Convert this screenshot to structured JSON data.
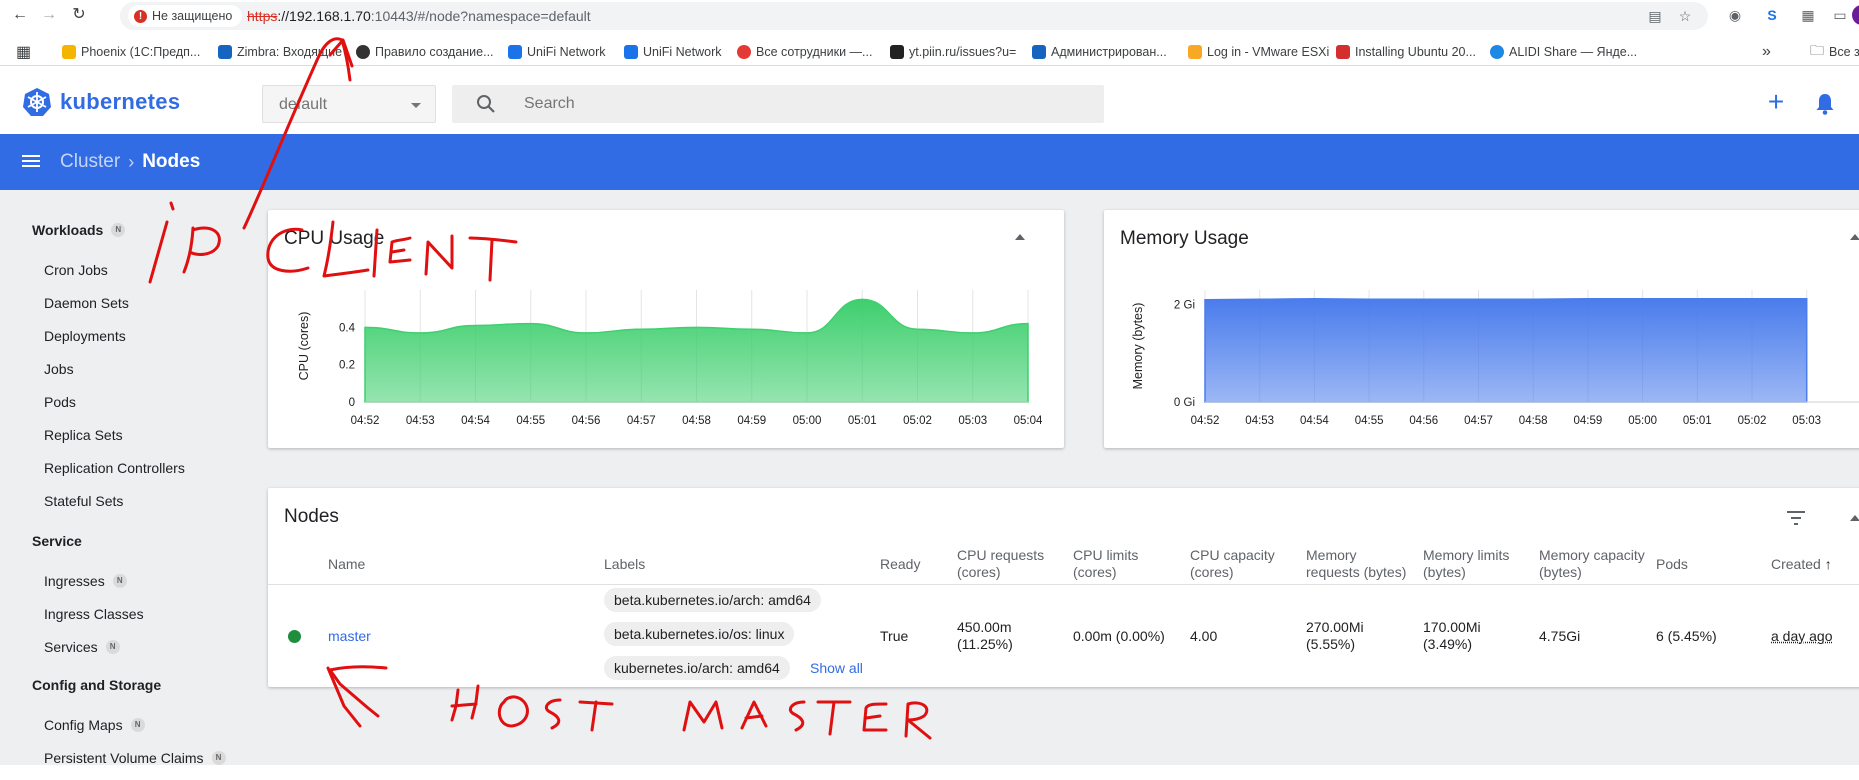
{
  "browser": {
    "security_label": "Не защищено",
    "url_scheme": "https",
    "url_rest_host": "://192.168.1.70",
    "url_path": ":10443/#/node?namespace=default",
    "bookmarks": [
      {
        "label": "Phoenix (1С:Предп...",
        "color": "#f4b400"
      },
      {
        "label": "Zimbra: Входящие",
        "color": "#1565c0"
      },
      {
        "label": "Правило создание...",
        "color": "#333333"
      },
      {
        "label": "UniFi Network",
        "color": "#1a73e8"
      },
      {
        "label": "UniFi Network",
        "color": "#1a73e8"
      },
      {
        "label": "Все сотрудники —...",
        "color": "#e53935"
      },
      {
        "label": "yt.piin.ru/issues?u=",
        "color": "#222222"
      },
      {
        "label": "Администрирован...",
        "color": "#1565c0"
      },
      {
        "label": "Log in - VMware ESXi",
        "color": "#f9a825"
      },
      {
        "label": "Installing Ubuntu 20...",
        "color": "#d32f2f"
      },
      {
        "label": "ALIDI Share — Янде...",
        "color": "#1e88e5"
      },
      {
        "label": "Все з",
        "color": "#5f6368"
      }
    ]
  },
  "header": {
    "logo_text": "kubernetes",
    "namespace": "default",
    "search_placeholder": "Search"
  },
  "breadcrumb": {
    "parent": "Cluster",
    "current": "Nodes"
  },
  "sidebar": {
    "groups": [
      {
        "title": "Workloads",
        "badge": "N",
        "items": [
          {
            "label": "Cron Jobs",
            "badge": ""
          },
          {
            "label": "Daemon Sets",
            "badge": ""
          },
          {
            "label": "Deployments",
            "badge": ""
          },
          {
            "label": "Jobs",
            "badge": ""
          },
          {
            "label": "Pods",
            "badge": ""
          },
          {
            "label": "Replica Sets",
            "badge": ""
          },
          {
            "label": "Replication Controllers",
            "badge": ""
          },
          {
            "label": "Stateful Sets",
            "badge": ""
          }
        ]
      },
      {
        "title": "Service",
        "badge": "",
        "items": [
          {
            "label": "Ingresses",
            "badge": "N"
          },
          {
            "label": "Ingress Classes",
            "badge": ""
          },
          {
            "label": "Services",
            "badge": "N"
          }
        ]
      },
      {
        "title": "Config and Storage",
        "badge": "",
        "items": [
          {
            "label": "Config Maps",
            "badge": "N"
          },
          {
            "label": "Persistent Volume Claims",
            "badge": "N"
          }
        ]
      }
    ]
  },
  "cpu_card": {
    "title": "CPU Usage"
  },
  "memory_card": {
    "title": "Memory Usage"
  },
  "chart_data": [
    {
      "type": "area",
      "title": "CPU Usage",
      "xlabel": "",
      "ylabel": "CPU (cores)",
      "x": [
        "04:52",
        "04:53",
        "04:54",
        "04:55",
        "04:56",
        "04:57",
        "04:58",
        "04:59",
        "05:00",
        "05:01",
        "05:02",
        "05:03",
        "05:04"
      ],
      "values": [
        0.4,
        0.37,
        0.41,
        0.42,
        0.37,
        0.39,
        0.4,
        0.39,
        0.37,
        0.55,
        0.39,
        0.37,
        0.42
      ],
      "yticks": [
        "0",
        "0.2",
        "0.4"
      ],
      "ylim": [
        0,
        0.6
      ],
      "color": "#3ecf6e",
      "grid": true
    },
    {
      "type": "area",
      "title": "Memory Usage",
      "xlabel": "",
      "ylabel": "Memory (bytes)",
      "x": [
        "04:52",
        "04:53",
        "04:54",
        "04:55",
        "04:56",
        "04:57",
        "04:58",
        "04:59",
        "05:00",
        "05:01",
        "05:02",
        "05:03"
      ],
      "values": [
        2.1,
        2.11,
        2.12,
        2.11,
        2.11,
        2.11,
        2.11,
        2.12,
        2.12,
        2.12,
        2.12,
        2.12
      ],
      "yticks": [
        "0 Gi",
        "2 Gi"
      ],
      "ylim": [
        0,
        2.3
      ],
      "color": "#4a7cec",
      "grid": true
    }
  ],
  "nodes": {
    "title": "Nodes",
    "columns": {
      "name": "Name",
      "labels": "Labels",
      "ready": "Ready",
      "cpu_requests": [
        "CPU requests",
        "(cores)"
      ],
      "cpu_limits": [
        "CPU limits",
        "(cores)"
      ],
      "cpu_capacity": [
        "CPU capacity",
        "(cores)"
      ],
      "mem_requests": [
        "Memory",
        "requests (bytes)"
      ],
      "mem_limits": [
        "Memory limits",
        "(bytes)"
      ],
      "mem_capacity": [
        "Memory capacity",
        "(bytes)"
      ],
      "pods": "Pods",
      "created": "Created"
    },
    "rows": [
      {
        "name": "master",
        "status_color": "#1e8e3e",
        "labels": [
          "beta.kubernetes.io/arch: amd64",
          "beta.kubernetes.io/os: linux",
          "kubernetes.io/arch: amd64"
        ],
        "show_all": "Show all",
        "ready": "True",
        "cpu_requests": [
          "450.00m",
          "(11.25%)"
        ],
        "cpu_limits": "0.00m (0.00%)",
        "cpu_capacity": "4.00",
        "mem_requests": [
          "270.00Mi",
          "(5.55%)"
        ],
        "mem_limits": [
          "170.00Mi",
          "(3.49%)"
        ],
        "mem_capacity": "4.75Gi",
        "pods": "6 (5.45%)",
        "created": "a day ago"
      }
    ]
  }
}
